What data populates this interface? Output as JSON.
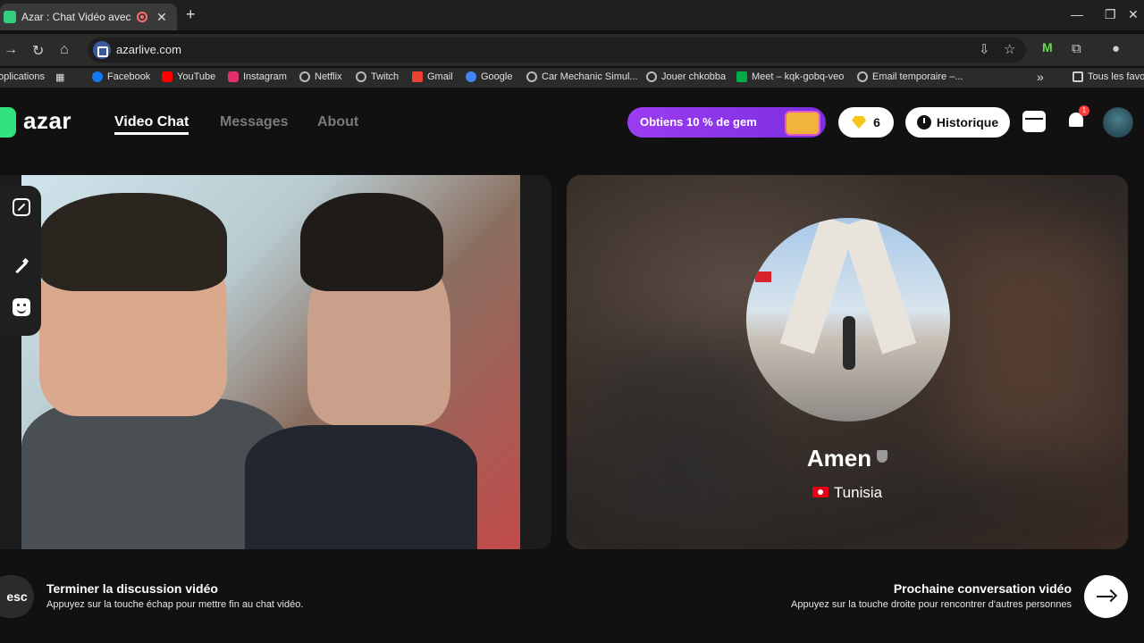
{
  "browser": {
    "tab_title": "Azar : Chat Vidéo avec de n",
    "tab_close": "✕",
    "new_tab": "+",
    "url": "azarlive.com",
    "window_controls": [
      "—",
      "❐",
      "✕"
    ]
  },
  "bookmarks": [
    {
      "label": "oplications",
      "color": "transparent"
    },
    {
      "label": "Facebook",
      "color": "#1877f2"
    },
    {
      "label": "YouTube",
      "color": "#ff0000"
    },
    {
      "label": "Instagram",
      "color": "#e1306c"
    },
    {
      "label": "Netflix",
      "color": "#bbbbbb"
    },
    {
      "label": "Twitch",
      "color": "#bbbbbb"
    },
    {
      "label": "Gmail",
      "color": "#ea4335"
    },
    {
      "label": "Google",
      "color": "#4285f4"
    },
    {
      "label": "Car Mechanic Simul...",
      "color": "#bbbbbb"
    },
    {
      "label": "Jouer chkobba",
      "color": "#bbbbbb"
    },
    {
      "label": "Meet – kqk-gobq-veo",
      "color": "#00ac47"
    },
    {
      "label": "Email temporaire –...",
      "color": "#bbbbbb"
    }
  ],
  "bookmarks_more": "»",
  "bookmarks_folder": "Tous les favo",
  "app": {
    "logo": "azar",
    "nav": {
      "video_chat": "Video Chat",
      "messages": "Messages",
      "about": "About"
    },
    "promo": "Obtiens 10 % de gem",
    "gems": "6",
    "history": "Historique",
    "notification_count": "1"
  },
  "peer": {
    "name": "Amen",
    "country": "Tunisia"
  },
  "actions": {
    "end_key": "esc",
    "end_title": "Terminer la discussion vidéo",
    "end_sub": "Appuyez sur la touche échap pour mettre fin au chat vidéo.",
    "next_title": "Prochaine conversation vidéo",
    "next_sub": "Appuyez sur la touche droite pour rencontrer d'autres personnes"
  },
  "colors": {
    "accent_green": "#33e27d",
    "promo_purple": "#9b3cf0",
    "badge_red": "#ff3b3b"
  }
}
